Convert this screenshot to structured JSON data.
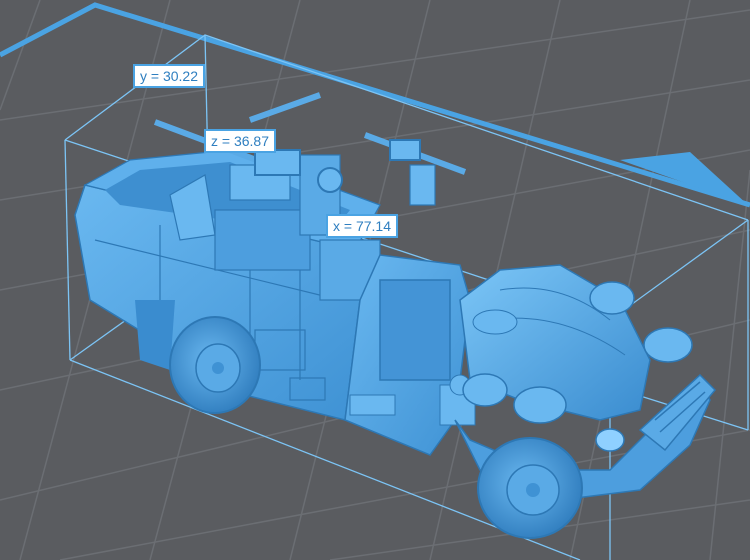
{
  "viewport": {
    "background_color": "#5a5c60",
    "grid_color": "#6b6e73",
    "bed_border_color": "#4aa3e3",
    "bounding_box_color": "#7cc4f5",
    "model_color": "#58a9e6",
    "model_shadow_color": "#2d78b5",
    "model_highlight_color": "#8fd0ff"
  },
  "dimensions": {
    "y": {
      "axis": "y",
      "value": "30.22",
      "text": "y = 30.22"
    },
    "z": {
      "axis": "z",
      "value": "36.87",
      "text": "z = 36.87"
    },
    "x": {
      "axis": "x",
      "value": "77.14",
      "text": "x = 77.14"
    }
  },
  "model": {
    "name": "military-truck-model"
  }
}
